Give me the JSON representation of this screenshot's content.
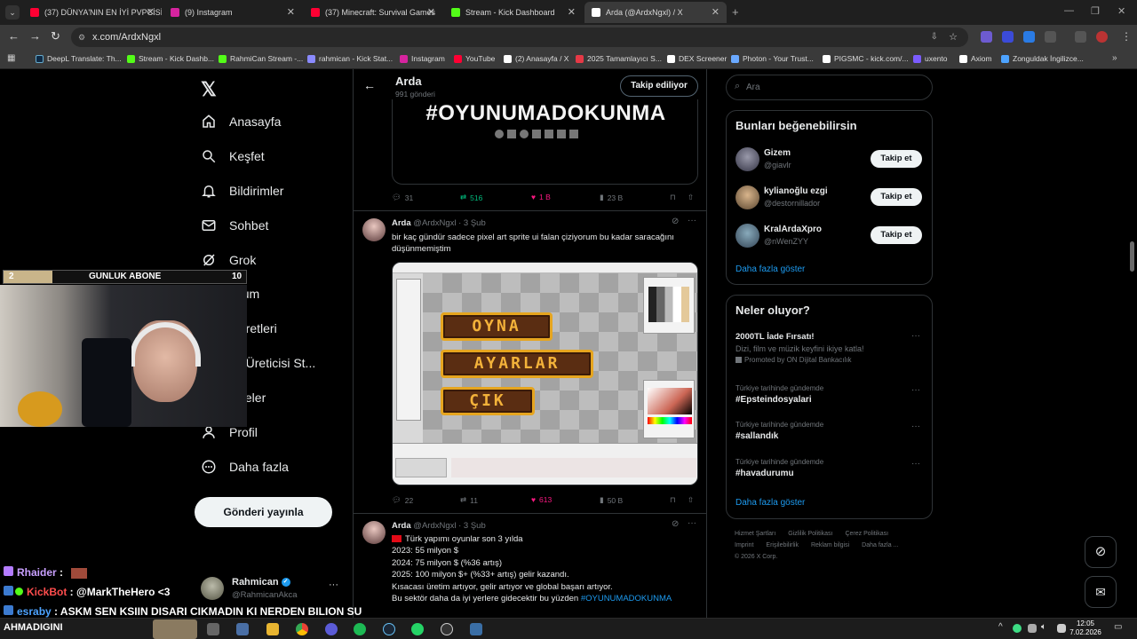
{
  "tabs": [
    {
      "label": "(37) DÜNYA'NIN EN İYİ PVPCİSİ",
      "color": "#ff0033"
    },
    {
      "label": "(9) Instagram",
      "color": "#d6249f"
    },
    {
      "label": "(37) Minecraft: Survival Games",
      "color": "#ff0033"
    },
    {
      "label": "Stream - Kick Dashboard",
      "color": "#53fc18"
    },
    {
      "label": "Arda (@ArdxNgxl) / X",
      "color": "#ffffff"
    }
  ],
  "new_tab": "+",
  "url": "x.com/ArdxNgxl",
  "bookmarks": [
    {
      "label": "DeepL Translate: Th...",
      "color": "#0f2b46"
    },
    {
      "label": "Stream - Kick Dashb...",
      "color": "#53fc18"
    },
    {
      "label": "RahmiCan Stream -...",
      "color": "#53fc18"
    },
    {
      "label": "rahmican - Kick Stat...",
      "color": "#8a8aff"
    },
    {
      "label": "Instagram",
      "color": "#d6249f"
    },
    {
      "label": "YouTube",
      "color": "#ff0033"
    },
    {
      "label": "(2) Anasayfa / X",
      "color": "#ffffff"
    },
    {
      "label": "2025 Tamamlayıcı S...",
      "color": "#e63946"
    },
    {
      "label": "DEX Screener",
      "color": "#ffffff"
    },
    {
      "label": "Photon - Your Trust...",
      "color": "#6aa9ff"
    },
    {
      "label": "PIGSMC - kick.com/...",
      "color": "#ffffff"
    },
    {
      "label": "uxento",
      "color": "#7b5cff"
    },
    {
      "label": "Axiom",
      "color": "#ffffff"
    },
    {
      "label": "Zonguldak İngilizce...",
      "color": "#4da3ff"
    }
  ],
  "nav": {
    "items": [
      {
        "label": "Anasayfa",
        "icon": "home-icon"
      },
      {
        "label": "Keşfet",
        "icon": "search-icon"
      },
      {
        "label": "Bildirimler",
        "icon": "bell-icon"
      },
      {
        "label": "Sohbet",
        "icon": "mail-icon"
      },
      {
        "label": "Grok",
        "icon": "grok-icon"
      },
      {
        "label": "mium",
        "icon": ""
      },
      {
        "label": "İşaretleri",
        "icon": ""
      },
      {
        "label": "rik Üreticisi St...",
        "icon": ""
      },
      {
        "label": "kaleler",
        "icon": ""
      },
      {
        "label": "Profil",
        "icon": "person-icon"
      },
      {
        "label": "Daha fazla",
        "icon": "more-icon"
      }
    ],
    "post_button": "Gönderi yayınla",
    "account": {
      "name": "Rahmican",
      "handle": "@RahmicanAkca",
      "more": "···"
    }
  },
  "profile_header": {
    "name": "Arda",
    "posts": "991 gönderi",
    "follow_state": "Takip ediliyor"
  },
  "post1": {
    "banner_text": "#OYUNUMADOKUNMA",
    "stats": {
      "replies": "31",
      "reposts": "516",
      "likes": "1 B",
      "views": "23 B"
    }
  },
  "post2": {
    "name": "Arda",
    "handle": "@ArdxNgxl",
    "date": "· 3 Şub",
    "text": "bir kaç gündür sadece pixel art sprite ui falan çiziyorum bu kadar saracağını düşünmemiştim",
    "image_buttons": [
      "OYNA",
      "AYARLAR",
      "ÇIK"
    ],
    "stats": {
      "replies": "22",
      "reposts": "11",
      "likes": "613",
      "views": "50 B"
    }
  },
  "post3": {
    "name": "Arda",
    "handle": "@ArdxNgxl",
    "date": "· 3 Şub",
    "lines": [
      "Türk yapımı oyunlar son 3 yılda",
      "2023: 55 milyon $",
      "2024: 75 milyon $ (%36 artış)",
      "2025: 100 milyon $+ (%33+ artış) gelir kazandı.",
      "Kısacası üretim artıyor, gelir artıyor ve global başarı artıyor.",
      "Bu sektör daha da iyi yerlere gidecektir bu yüzden"
    ],
    "hashtag": "#OYUNUMADOKUNMA"
  },
  "search_placeholder": "Ara",
  "suggestions": {
    "title": "Bunları beğenebilirsin",
    "people": [
      {
        "name": "Gizem",
        "handle": "@giavlr",
        "button": "Takip et"
      },
      {
        "name": "kylianoğlu ezgi",
        "handle": "@destornillador",
        "button": "Takip et"
      },
      {
        "name": "KralArdaXpro",
        "handle": "@nWenZYY",
        "button": "Takip et"
      }
    ],
    "more": "Daha fazla göster"
  },
  "trends": {
    "title": "Neler oluyor?",
    "promo": {
      "title": "2000TL İade Fırsatı!",
      "desc": "Dizi, film ve müzik keyfini ikiye katla!",
      "by": "Promoted by ON Dijital Bankacılık"
    },
    "items": [
      {
        "context": "Türkiye tarihinde gündemde",
        "tag": "#Epsteindosyalari"
      },
      {
        "context": "Türkiye tarihinde gündemde",
        "tag": "#sallandık"
      },
      {
        "context": "Türkiye tarihinde gündemde",
        "tag": "#havadurumu"
      }
    ],
    "more": "Daha fazla göster",
    "menu": "···"
  },
  "footer": {
    "row1": [
      "Hizmet Şartları",
      "Gizlilik Politikası",
      "Çerez Politikası"
    ],
    "row2": [
      "Imprint",
      "Erişilebilirlik",
      "Reklam bilgisi",
      "Daha fazla ..."
    ],
    "copyright": "© 2026 X Corp."
  },
  "stream_overlay": {
    "goal_current": "2",
    "goal_label": "GUNLUK ABONE",
    "goal_target": "10",
    "goal_progress": 0.2
  },
  "chat": [
    {
      "user": "Rhaider",
      "sep": " :",
      "msg": "",
      "color": "#c9a0ff"
    },
    {
      "user": "KickBot",
      "sep": " :",
      "msg": " @MarkTheHero <3",
      "color": "#ff4d4d"
    },
    {
      "user": "esraby",
      "sep": " :",
      "msg": " ASKM SEN KSIIN DISARI CIKMADIN KI NERDEN BILION SU",
      "color": "#4da3ff"
    }
  ],
  "chat_tail": "AHMADIGINI",
  "clock": {
    "time": "12:05",
    "date": "7.02.2026"
  },
  "colors": {
    "accent": "#1d9bf0",
    "like": "#f91880",
    "repost": "#00ba7c",
    "kick": "#53fc18"
  }
}
